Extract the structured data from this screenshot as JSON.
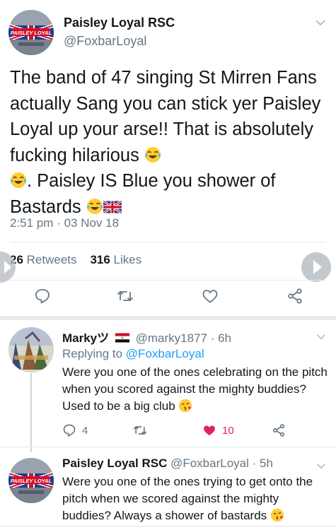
{
  "main_tweet": {
    "author_name": "Paisley Loyal RSC",
    "author_handle": "@FoxbarLoyal",
    "avatar_text": "PAISLEY LOYAL",
    "text_1": "The band of 47 singing St Mirren Fans actually Sang you can stick yer Paisley Loyal up your arse!!  That is absolutely fucking hilarious ",
    "text_2": ".  Paisley IS Blue you shower of Bastards ",
    "time": "2:51 pm",
    "separator": "·",
    "date": "03 Nov 18",
    "retweets_count": "26",
    "retweets_label": "Retweets",
    "likes_count": "316",
    "likes_label": "Likes",
    "icons": [
      "laughing-emoji",
      "uk-flag-emoji",
      "reply-icon",
      "retweet-icon",
      "like-icon",
      "share-icon",
      "chevron-down-icon",
      "play-next-icon"
    ]
  },
  "replies": [
    {
      "name": "Marky",
      "name_suffix": "ツ",
      "handle": "@marky1877",
      "separator": "·",
      "time": "6h",
      "replying_prefix": "Replying to",
      "replying_to": "@FoxbarLoyal",
      "text": "Were you one of the ones celebrating on the pitch when you scored against the mighty buddies? Used to be a big club ",
      "reply_count": "4",
      "like_count": "10",
      "liked": true,
      "icons": [
        "egypt-flag-emoji",
        "kissing-emoji"
      ]
    },
    {
      "name": "Paisley Loyal RSC",
      "handle": "@FoxbarLoyal",
      "separator": "·",
      "time": "5h",
      "avatar_text": "PAISLEY LOYAL",
      "text": "Were you one of the ones trying to get onto the pitch when we scored against the mighty buddies? Always a shower of bastards ",
      "icons": [
        "kissing-emoji"
      ]
    }
  ],
  "colors": {
    "accent": "#1da1f2",
    "secondary_text": "#657786",
    "like": "#e0245e",
    "divider": "#e1e8ed"
  }
}
